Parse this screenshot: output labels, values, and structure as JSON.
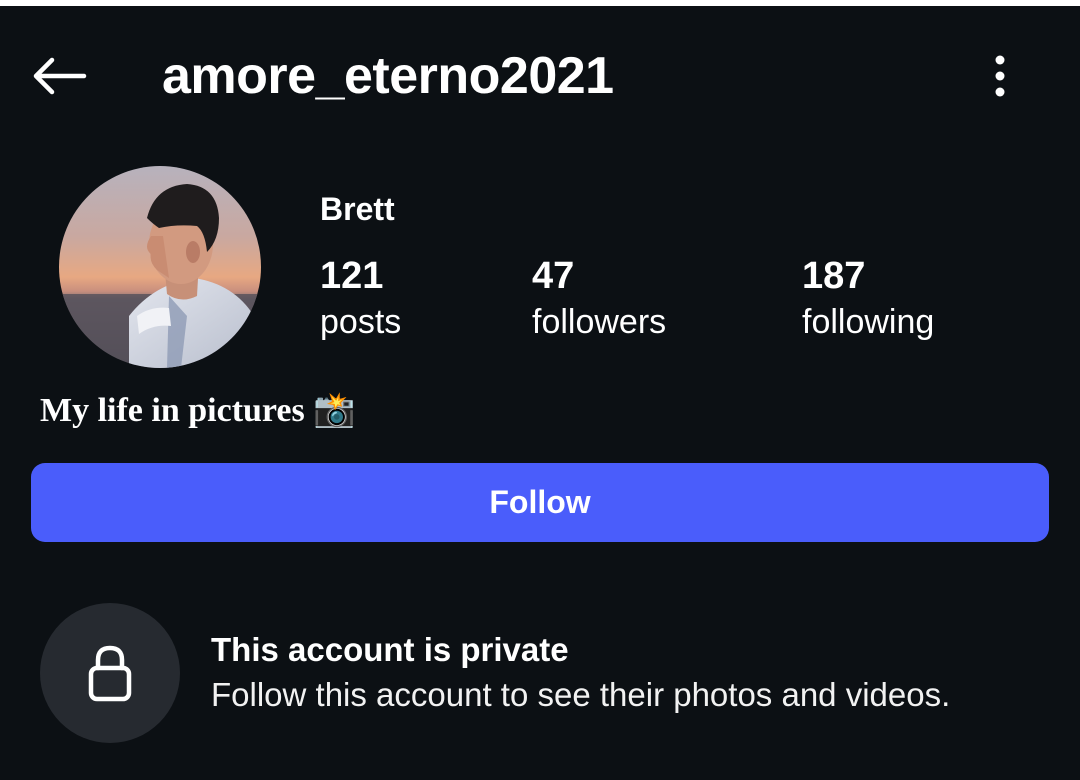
{
  "header": {
    "username": "amore_eterno2021",
    "back_icon": "arrow-left-icon",
    "more_icon": "more-vertical-icon"
  },
  "profile": {
    "display_name": "Brett",
    "avatar_icon": "profile-avatar",
    "stats": [
      {
        "value": "121",
        "label": "posts"
      },
      {
        "value": "47",
        "label": "followers"
      },
      {
        "value": "187",
        "label": "following"
      }
    ],
    "bio": "My life in pictures 📸"
  },
  "actions": {
    "follow_label": "Follow"
  },
  "private_notice": {
    "icon": "lock-icon",
    "title": "This account is private",
    "subtitle": "Follow this account to see their photos and videos."
  },
  "colors": {
    "background": "#0c1014",
    "follow_button": "#4a5dfb",
    "lock_circle": "#262a30"
  }
}
